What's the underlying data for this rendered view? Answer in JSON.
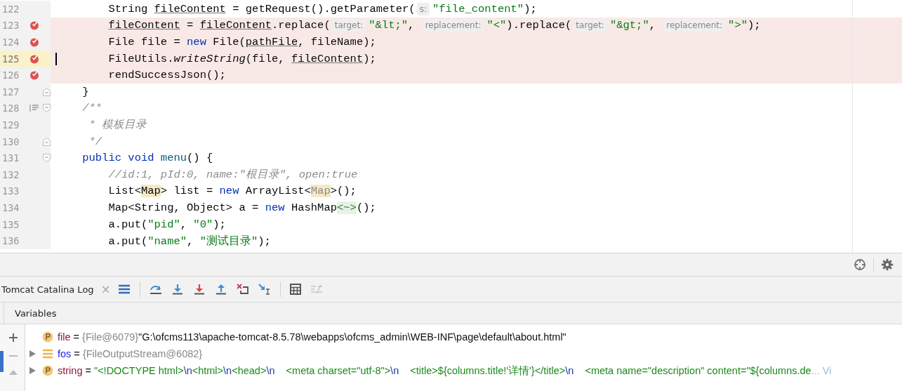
{
  "editor": {
    "lines": [
      {
        "number": "122",
        "breakpoint": false,
        "current": false,
        "tokens": [
          {
            "kind": "p",
            "t": "        String "
          },
          {
            "kind": "u",
            "t": "fileContent"
          },
          {
            "kind": "p",
            "t": " = getRequest().getParameter("
          },
          {
            "kind": "h",
            "t": "s:"
          },
          {
            "kind": "s",
            "t": "\"file_content\""
          },
          {
            "kind": "p",
            "t": ");"
          }
        ]
      },
      {
        "number": "123",
        "breakpoint": true,
        "current": false,
        "tokens": [
          {
            "kind": "u",
            "t": "        fileContent"
          },
          {
            "kind": "p",
            "t": " = "
          },
          {
            "kind": "u",
            "t": "fileContent"
          },
          {
            "kind": "p",
            "t": ".replace("
          },
          {
            "kind": "h",
            "t": "target:"
          },
          {
            "kind": "s",
            "t": "\"&lt;\""
          },
          {
            "kind": "p",
            "t": ", "
          },
          {
            "kind": "h",
            "t": "replacement:"
          },
          {
            "kind": "s",
            "t": "\"<\""
          },
          {
            "kind": "p",
            "t": ").replace("
          },
          {
            "kind": "h",
            "t": "target:"
          },
          {
            "kind": "s",
            "t": "\"&gt;\""
          },
          {
            "kind": "p",
            "t": ", "
          },
          {
            "kind": "h",
            "t": "replacement:"
          },
          {
            "kind": "s",
            "t": "\">\""
          },
          {
            "kind": "p",
            "t": ");"
          }
        ]
      },
      {
        "number": "124",
        "breakpoint": true,
        "current": false,
        "tokens": [
          {
            "kind": "p",
            "t": "        File file = "
          },
          {
            "kind": "kw",
            "t": "new"
          },
          {
            "kind": "p",
            "t": " File("
          },
          {
            "kind": "u",
            "t": "pathFile"
          },
          {
            "kind": "p",
            "t": ", fileName);"
          }
        ]
      },
      {
        "number": "125",
        "breakpoint": true,
        "current": true,
        "tokens": [
          {
            "kind": "p",
            "t": "        FileUtils."
          },
          {
            "kind": "i",
            "t": "writeString"
          },
          {
            "kind": "p",
            "t": "(file, "
          },
          {
            "kind": "u",
            "t": "fileContent"
          },
          {
            "kind": "p",
            "t": ");"
          }
        ]
      },
      {
        "number": "126",
        "breakpoint": true,
        "current": false,
        "tokens": [
          {
            "kind": "p",
            "t": "        rendSuccessJson();"
          }
        ]
      },
      {
        "number": "127",
        "breakpoint": false,
        "current": false,
        "fold_marker": {
          "kind": "end"
        },
        "tokens": [
          {
            "kind": "p",
            "t": "    }"
          }
        ]
      },
      {
        "number": "128",
        "breakpoint": false,
        "current": false,
        "fold_marker": {
          "kind": "start"
        },
        "doc_icon": true,
        "tokens": [
          {
            "kind": "c",
            "t": "    /**"
          }
        ]
      },
      {
        "number": "129",
        "breakpoint": false,
        "current": false,
        "tokens": [
          {
            "kind": "c",
            "t": "     * 模板目录"
          }
        ]
      },
      {
        "number": "130",
        "breakpoint": false,
        "current": false,
        "fold_marker": {
          "kind": "end"
        },
        "tokens": [
          {
            "kind": "c",
            "t": "     */"
          }
        ]
      },
      {
        "number": "131",
        "breakpoint": false,
        "current": false,
        "fold_marker": {
          "kind": "start"
        },
        "tokens": [
          {
            "kind": "kw",
            "t": "    public void "
          },
          {
            "kind": "m",
            "t": "menu"
          },
          {
            "kind": "p",
            "t": "() {"
          }
        ]
      },
      {
        "number": "132",
        "breakpoint": false,
        "current": false,
        "tokens": [
          {
            "kind": "c",
            "t": "        //id:1, pId:0, name:\"根目录\", open:true"
          }
        ]
      },
      {
        "number": "133",
        "breakpoint": false,
        "current": false,
        "tokens": [
          {
            "kind": "p",
            "t": "        List<"
          },
          {
            "kind": "y",
            "t": "Map"
          },
          {
            "kind": "p",
            "t": "> list = "
          },
          {
            "kind": "kw",
            "t": "new"
          },
          {
            "kind": "p",
            "t": " ArrayList<"
          },
          {
            "kind": "yg",
            "t": "Map"
          },
          {
            "kind": "p",
            "t": ">();"
          }
        ]
      },
      {
        "number": "134",
        "breakpoint": false,
        "current": false,
        "tokens": [
          {
            "kind": "p",
            "t": "        Map<String, Object> a = "
          },
          {
            "kind": "kw",
            "t": "new"
          },
          {
            "kind": "p",
            "t": " HashMap"
          },
          {
            "kind": "g",
            "t": "<~>"
          },
          {
            "kind": "p",
            "t": "();"
          }
        ]
      },
      {
        "number": "135",
        "breakpoint": false,
        "current": false,
        "tokens": [
          {
            "kind": "p",
            "t": "        a.put("
          },
          {
            "kind": "s",
            "t": "\"pid\""
          },
          {
            "kind": "p",
            "t": ", "
          },
          {
            "kind": "s",
            "t": "\"0\""
          },
          {
            "kind": "p",
            "t": ");"
          }
        ]
      },
      {
        "number": "136",
        "breakpoint": false,
        "current": false,
        "tokens": [
          {
            "kind": "p",
            "t": "        a.put("
          },
          {
            "kind": "s",
            "t": "\"name\""
          },
          {
            "kind": "p",
            "t": ", "
          },
          {
            "kind": "s",
            "t": "\"测试目录\""
          },
          {
            "kind": "p",
            "t": ");"
          }
        ]
      }
    ]
  },
  "debug_tab": {
    "label": "Tomcat Catalina Log",
    "close": "×"
  },
  "toolbar": [
    {
      "kind": "frames",
      "disabled": false
    },
    {
      "kind": "step-over",
      "disabled": false
    },
    {
      "kind": "step-into",
      "disabled": false
    },
    {
      "kind": "force-step-into",
      "disabled": false
    },
    {
      "kind": "step-out",
      "disabled": false
    },
    {
      "kind": "drop-frame",
      "disabled": false
    },
    {
      "kind": "run-to-cursor",
      "disabled": false
    },
    {
      "kind": "evaluate",
      "disabled": false
    },
    {
      "kind": "trace",
      "disabled": true
    }
  ],
  "variables_header": "Variables",
  "variables": [
    {
      "kind": "primitive",
      "expandable": false,
      "name": "file",
      "eq": "=",
      "type": "{File@6079}",
      "value": [
        {
          "kind": "plain",
          "t": "\"G:\\ofcms113\\apache-tomcat-8.5.78\\webapps\\ofcms_admin\\WEB-INF\\page\\default\\about.html\""
        }
      ]
    },
    {
      "kind": "object",
      "expandable": true,
      "name": "fos",
      "eq": "=",
      "type": "{FileOutputStream@6082}"
    },
    {
      "kind": "primitive",
      "expandable": true,
      "name": "string",
      "eq": "=",
      "value": [
        {
          "kind": "str",
          "t": "\"<!DOCTYPE html>"
        },
        {
          "kind": "esc",
          "t": "\\n"
        },
        {
          "kind": "str",
          "t": "<html>"
        },
        {
          "kind": "esc",
          "t": "\\n"
        },
        {
          "kind": "str",
          "t": "<head>"
        },
        {
          "kind": "esc",
          "t": "\\n"
        },
        {
          "kind": "str",
          "t": "    <meta charset=\"utf-8\">"
        },
        {
          "kind": "esc",
          "t": "\\n"
        },
        {
          "kind": "str",
          "t": "    <title>${columns.title!'详情'}</title>"
        },
        {
          "kind": "esc",
          "t": "\\n"
        },
        {
          "kind": "str",
          "t": "    <meta name=\"description\" content=\"${columns.de"
        },
        {
          "kind": "more",
          "t": "... Vi"
        }
      ]
    }
  ]
}
